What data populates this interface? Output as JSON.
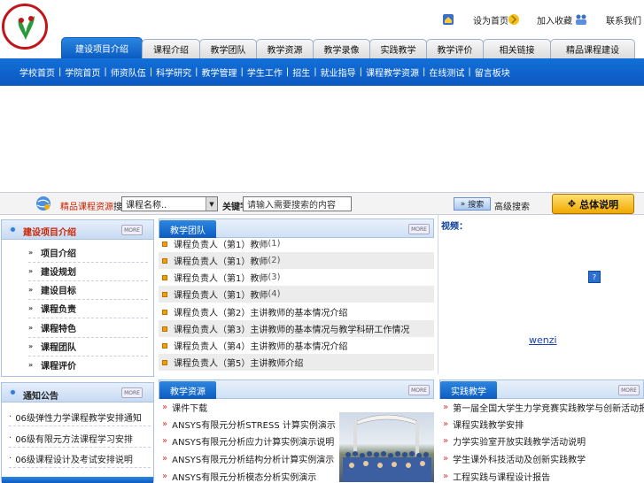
{
  "colors": {
    "primary_blue": "#0a5bc2",
    "accent_red": "#cc2200",
    "gold": "#f0a800"
  },
  "header": {
    "logo_name": "university-logo",
    "top_links": [
      {
        "label": "设为首页",
        "icon": "home-icon"
      },
      {
        "label": "加入收藏",
        "icon": "favorite-icon"
      },
      {
        "label": "联系我们",
        "icon": "contact-icon"
      }
    ]
  },
  "tabs": [
    {
      "label": "建设项目介绍"
    },
    {
      "label": "课程介绍"
    },
    {
      "label": "教学团队"
    },
    {
      "label": "教学资源"
    },
    {
      "label": "教学录像"
    },
    {
      "label": "实践教学"
    },
    {
      "label": "教学评价"
    },
    {
      "label": "相关链接"
    },
    {
      "label": "精品课程建设"
    }
  ],
  "subnav": [
    "学校首页",
    "学院首页",
    "师资队伍",
    "科学研究",
    "教学管理",
    "学生工作",
    "招生",
    "就业指导",
    "课程教学资源",
    "在线测试",
    "留言板块"
  ],
  "search": {
    "label_red": "精品课程资源",
    "label_black": "搜索引擎",
    "select_value": "课程名称..",
    "keyword_label": "关键字",
    "input_value": "请输入需要搜索的内容",
    "button_label": "搜索",
    "advanced_label": "高级搜索",
    "overview_button": "总体说明"
  },
  "left_panel": {
    "title": "建设项目介绍",
    "more": "MORE",
    "items": [
      "项目介绍",
      "建设规划",
      "建设目标",
      "课程负责",
      "课程特色",
      "课程团队",
      "课程评价"
    ]
  },
  "left_panel2": {
    "title": "通知公告",
    "more": "MORE",
    "items": [
      "06级弹性力学课程教学安排通知",
      "06级有限元方法课程学习安排",
      "06级课程设计及考试安排说明"
    ]
  },
  "center_panel": {
    "title": "教学团队",
    "more": "MORE",
    "items": [
      {
        "text": "课程负责人（第1）教师",
        "count": "(1)"
      },
      {
        "text": "课程负责人（第1）教师",
        "count": "(2)"
      },
      {
        "text": "课程负责人（第1）教师",
        "count": "(3)"
      },
      {
        "text": "课程负责人（第1）教师",
        "count": "(4)"
      },
      {
        "text": "课程负责人（第2）主讲教师的基本情况介绍",
        "count": ""
      },
      {
        "text": "课程负责人（第3）主讲教师的基本情况与教学科研工作情况",
        "count": ""
      },
      {
        "text": "课程负责人（第4）主讲教师的基本情况介绍",
        "count": ""
      },
      {
        "text": "课程负责人（第5）主讲教师介绍",
        "count": ""
      }
    ]
  },
  "right_panel": {
    "title": "视频：",
    "help_icon": "help-icon",
    "link_text": "wenzi"
  },
  "center_panel2": {
    "title": "教学资源",
    "more": "MORE",
    "items": [
      "课件下载",
      "ANSYS有限元分析STRESS 计算实例演示",
      "ANSYS有限元分析应力计算实例演示说明",
      "ANSYS有限元分析结构分析计算实例演示",
      "ANSYS有限元分析模态分析实例演示"
    ]
  },
  "right_panel2": {
    "title": "实践教学",
    "more": "MORE",
    "items": [
      "第一届全国大学生力学竞赛实践教学与创新活动报告",
      "课程实践教学安排",
      "力学实验室开放实践教学活动说明",
      "学生课外科技活动及创新实践教学",
      "工程实践与课程设计报告"
    ]
  }
}
